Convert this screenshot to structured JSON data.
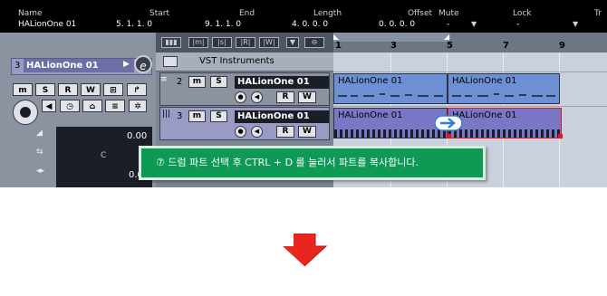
{
  "info_line": {
    "headers": {
      "name": "Name",
      "start": "Start",
      "end": "End",
      "length": "Length",
      "offset": "Offset",
      "mute": "Mute",
      "lock": "Lock",
      "trunc": "Tr"
    },
    "values": {
      "name": "HALionOne 01",
      "start": "5. 1. 1.   0",
      "end": "9. 1. 1.   0",
      "length": "4. 0. 0.   0",
      "offset": "0. 0. 0.   0",
      "mute": "-",
      "lock": "-"
    }
  },
  "inspector": {
    "track_number": "3",
    "track_name": "HALionOne 01",
    "edit_button": "e",
    "buttons_row1": [
      "m",
      "S",
      "R",
      "W"
    ],
    "volume_value": "0.00",
    "pan_value": "C",
    "delay_value": "0.0"
  },
  "track_list": {
    "folder_name": "VST Instruments",
    "tracks": [
      {
        "number": "2",
        "name": "HALionOne 01",
        "mute": "m",
        "solo": "S",
        "read": "R",
        "write": "W"
      },
      {
        "number": "3",
        "name": "HALionOne 01",
        "mute": "m",
        "solo": "S",
        "read": "R",
        "write": "W"
      }
    ]
  },
  "arrange": {
    "ruler_marks": [
      "1",
      "3",
      "5",
      "7",
      "9"
    ],
    "parts": [
      {
        "label": "HALionOne 01",
        "lane": "top",
        "copy": false
      },
      {
        "label": "HALionOne 01",
        "lane": "top",
        "copy": false
      },
      {
        "label": "HALionOne 01",
        "lane": "bottom",
        "copy": false
      },
      {
        "label": "HALionOne 01",
        "lane": "bottom",
        "copy": true
      }
    ],
    "colors": {
      "part_blue": "#6d8fd4",
      "part_purple": "#7b76c6",
      "selection_red": "#e0151e"
    }
  },
  "instruction": {
    "text": "⑦ 드럼 파트 선택 후 CTRL + D 를 눌러서 파트를 복사합니다.",
    "color": "#0e9a55"
  },
  "arrow_icon": {
    "color": "#e8261f"
  }
}
